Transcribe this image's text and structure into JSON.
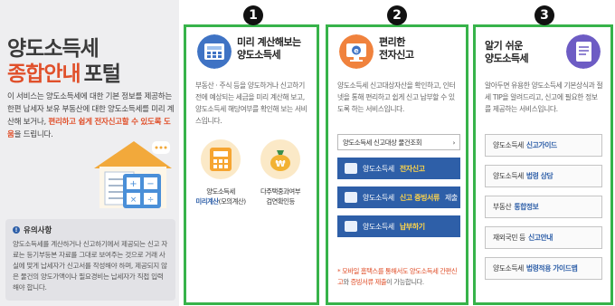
{
  "intro": {
    "title_line1": "양도소득세",
    "title_line2_highlight": "종합안내",
    "title_line2_rest": "포털",
    "desc_part1": "이 서비스는 양도소득세에 대한 기본 정보를 제공하는 한편 납세자 보유 부동산에 대한 양도소득세를 미리 계산해 보거나,",
    "desc_highlight": "편리하고 쉽게 전자신고할 수 있도록 도움",
    "desc_part2": "을 드립니다."
  },
  "notice": {
    "title": "유의사항",
    "body": "양도소득세를 계산하거나 신고하기에서 제공되는 신고 자료는 등기부등본 자료를 그대로 보여주는 것으로 거래 사실에 맞게 납세자가 신고서를 작성해야 하며, 제공되지 않은 물건의 양도가액이나 필요경비는 납세자가 직접 입력해야 합니다."
  },
  "panel1": {
    "number": "1",
    "title_line1": "미리 계산해보는",
    "title_line2": "양도소득세",
    "desc": "부동산 · 주식 등을 양도하거나 신고하기 전에 예상되는 세금을 미리 계산해 보고, 양도소득세 해당여부를 확인해 보는 서비스입니다.",
    "item1_line1": "양도소득세",
    "item1_line2_blue": "미리계산",
    "item1_line2_rest": "(모의계산)",
    "item2_line1": "다주택중과여부",
    "item2_line2": "검연확인등"
  },
  "panel2": {
    "number": "2",
    "title_line1": "편리한",
    "title_line2": "전자신고",
    "desc": "양도소득세 신고대상자산을 확인하고, 인터넷을 통해 편리하고 쉽게 신고 납부할 수 있도록 하는 서비스입니다.",
    "lookup_label": "양도소득세 신고대상 물건조회",
    "lookup_arrow": "›",
    "btn1_prefix": "양도소득세",
    "btn1_highlight": "전자신고",
    "btn2_prefix": "양도소득세",
    "btn2_highlight": "신고 증빙서류",
    "btn2_suffix": "제출",
    "btn3_prefix": "양도소득세",
    "btn3_highlight": "납부하기",
    "note_pre": "* 모바일 홈택스를 통해서도",
    "note_hl1": "양도소득세 간편신고",
    "note_mid": "와",
    "note_hl2": "증빙서류 제출",
    "note_post": "이 가능합니다."
  },
  "panel3": {
    "number": "3",
    "title_line1": "알기 쉬운",
    "title_line2": "양도소득세",
    "desc": "알아두면 유용한 양도소득세 기본상식과 절세 TIP을 알려드리고, 신고에 필요한 정보를 제공하는 서비스입니다.",
    "g1_prefix": "양도소득세",
    "g1_hl": "신고가이드",
    "g2_prefix": "양도소득세",
    "g2_hl": "법령 상담",
    "g3_prefix": "부동산",
    "g3_hl": "통합정보",
    "g4_prefix": "재외국민 등",
    "g4_hl": "신고안내",
    "g5_prefix": "양도소득세",
    "g5_hl": "법령적용 가이드맵"
  },
  "colors": {
    "accent_green": "#37b34a",
    "brand_blue": "#2e5fa8",
    "highlight_orange": "#e0502b"
  }
}
